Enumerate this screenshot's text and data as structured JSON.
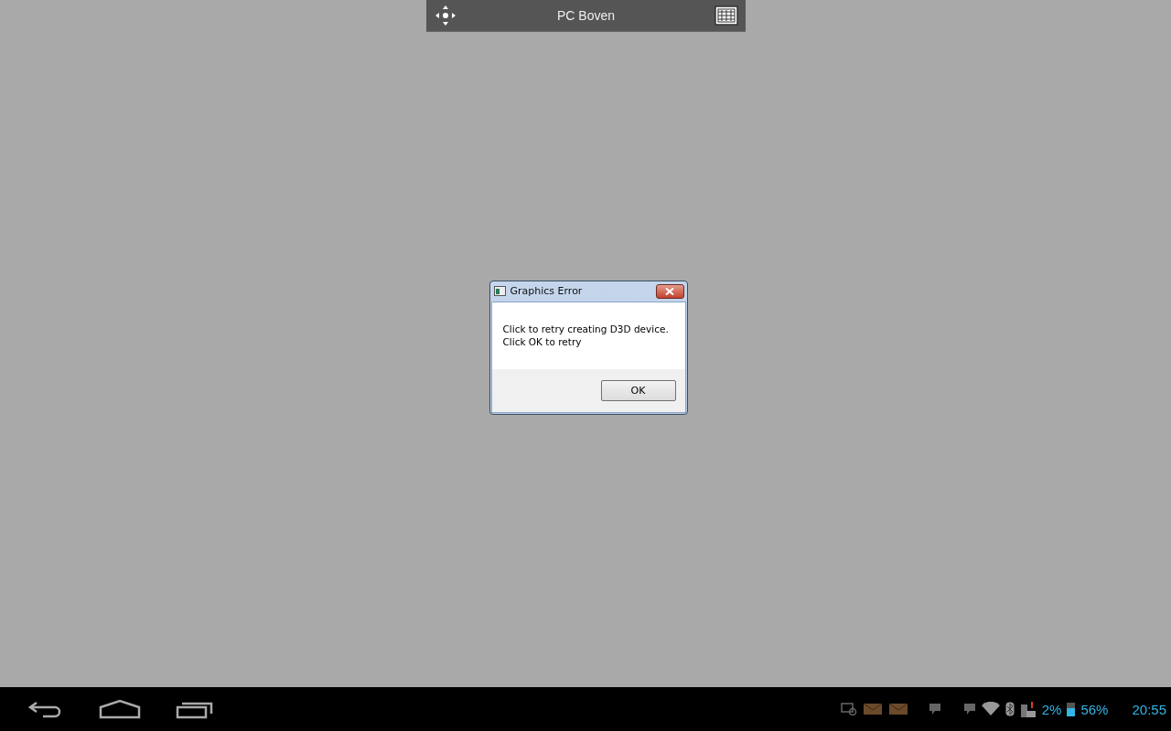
{
  "toolbar": {
    "title": "PC Boven"
  },
  "dialog": {
    "title": "Graphics Error",
    "message_lines": [
      "Click to retry creating D3D device.",
      "Click OK to retry"
    ],
    "buttons": [
      "OK"
    ]
  },
  "status_bar": {
    "keyboard_battery": "2%",
    "battery": "56%",
    "time": "20:55"
  }
}
